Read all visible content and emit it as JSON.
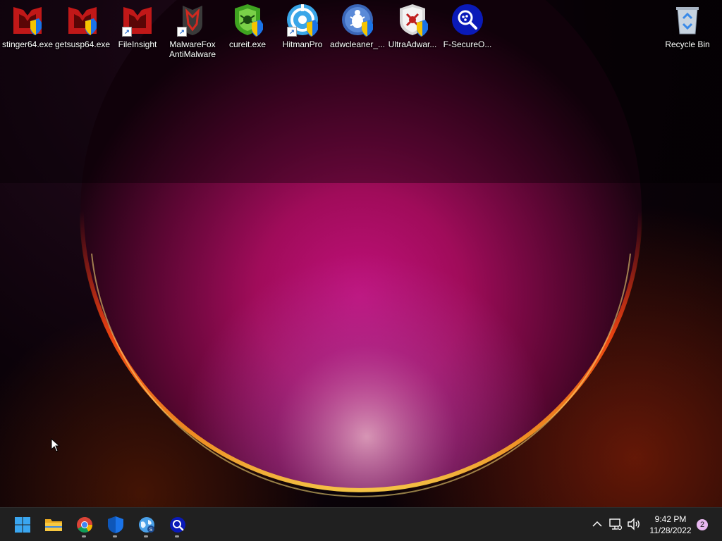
{
  "desktop": {
    "icons": [
      {
        "label": "stinger64.exe",
        "icon": "mcafee-shield-icon"
      },
      {
        "label": "getsusp64.exe",
        "icon": "mcafee-shield-icon"
      },
      {
        "label": "FileInsight",
        "icon": "mcafee-logo-icon"
      },
      {
        "label": "MalwareFox AntiMalware",
        "icon": "malwarefox-icon"
      },
      {
        "label": "cureit.exe",
        "icon": "drweb-spider-icon"
      },
      {
        "label": "HitmanPro",
        "icon": "hitmanpro-target-icon"
      },
      {
        "label": "adwcleaner_...",
        "icon": "adwcleaner-bug-icon"
      },
      {
        "label": "UltraAdwar...",
        "icon": "ultraadware-shield-icon"
      },
      {
        "label": "F-SecureO...",
        "icon": "fsecure-magnifier-icon"
      }
    ],
    "recycle_bin": {
      "label": "Recycle Bin",
      "icon": "recycle-bin-icon"
    }
  },
  "taskbar": {
    "apps": [
      {
        "name": "start",
        "icon": "windows-start-icon"
      },
      {
        "name": "file-explorer",
        "icon": "folder-icon"
      },
      {
        "name": "chrome",
        "icon": "chrome-icon"
      },
      {
        "name": "defender",
        "icon": "shield-icon"
      },
      {
        "name": "web-tool",
        "icon": "globe-icon"
      },
      {
        "name": "fsecure",
        "icon": "magnifier-icon"
      }
    ],
    "tray": {
      "time": "9:42 PM",
      "date": "11/28/2022",
      "notification_count": "2"
    }
  },
  "colors": {
    "taskbar_bg": "#202020",
    "mcafee_red": "#c01818",
    "accent_blue": "#1a73e8"
  }
}
